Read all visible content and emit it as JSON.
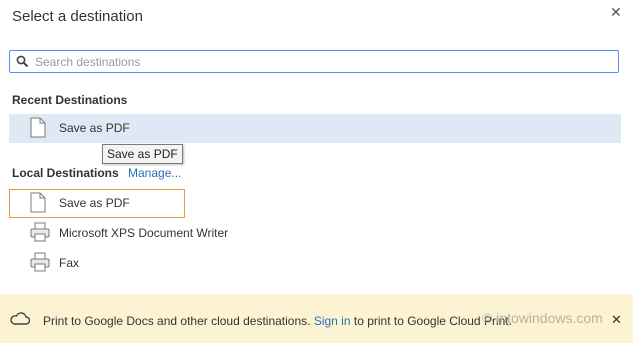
{
  "dialog": {
    "title": "Select a destination",
    "close_glyph": "✕"
  },
  "search": {
    "placeholder": "Search destinations",
    "value": "",
    "icon": "search-icon"
  },
  "recent": {
    "heading": "Recent Destinations",
    "items": [
      {
        "label": "Save as PDF",
        "icon": "document-icon",
        "selected": true
      }
    ]
  },
  "tooltip": {
    "text": "Save as PDF"
  },
  "local": {
    "heading": "Local Destinations",
    "manage_label": "Manage...",
    "items": [
      {
        "label": "Save as PDF",
        "icon": "document-icon",
        "focused": true
      },
      {
        "label": "Microsoft XPS Document Writer",
        "icon": "printer-icon"
      },
      {
        "label": "Fax",
        "icon": "printer-icon"
      }
    ]
  },
  "banner": {
    "text_before": "Print to Google Docs and other cloud destinations. ",
    "link": "Sign in",
    "text_after": " to print to Google Cloud Print.",
    "watermark": "© intowindows.com",
    "close_glyph": "✕",
    "icon": "cloud-icon"
  },
  "colors": {
    "accent_blue": "#4d90fe",
    "selected_row": "#dfe8f5",
    "focus_orange": "#e89b3c",
    "banner_bg": "#fbf3d2",
    "link": "#2a6ebb"
  }
}
